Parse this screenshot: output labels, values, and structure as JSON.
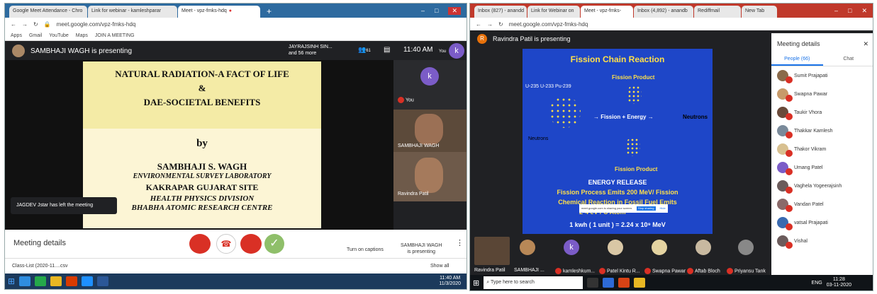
{
  "left": {
    "tabs": [
      "Google Meet Attendance - Chro",
      "Link for webinar - kamleshparar",
      "Meet - vpz-fmks-hdq"
    ],
    "url": "meet.google.com/vpz-fmks-hdq",
    "bookmarks": [
      "Apps",
      "Gmail",
      "YouTube",
      "Maps",
      "JOIN A MEETING"
    ],
    "presenter": "SAMBHAJI WAGH is presenting",
    "joined": "JAYRAJSINH SIN...",
    "joined_more": "and 56 more",
    "count": "61",
    "time": "11:40 AM",
    "you": "You",
    "avatar": "k",
    "slide": {
      "title1": "NATURAL RADIATION-A FACT OF LIFE",
      "amp": "&",
      "title2": "DAE-SOCIETAL BENEFITS",
      "by": "by",
      "author": "SAMBHAJI S. WAGH",
      "lab": "ENVIRONMENTAL SURVEY LABORATORY",
      "site": "KAKRAPAR GUJARAT SITE",
      "div": "HEALTH PHYSICS DIVISION",
      "centre": "BHABHA ATOMIC RESEARCH CENTRE"
    },
    "tiles": [
      "You",
      "SAMBHAJI WAGH",
      "Ravindra Patil"
    ],
    "toast": "JAGDEV Jstar has left the meeting",
    "details": "Meeting details",
    "captions": "Turn on captions",
    "presenting1": "SAMBHAJI WAGH",
    "presenting2": "is presenting",
    "download": "Class-List (2020-11....csv",
    "show_all": "Show all",
    "tray_time": "11:40 AM",
    "tray_date": "11/3/2020"
  },
  "right": {
    "tabs": [
      "Inbox (827) - anandd",
      "Link for Webinar on",
      "Meet - vpz-fmks-",
      "Inbox (4,892) - anandb",
      "Rediffmail",
      "New Tab"
    ],
    "url": "meet.google.com/vpz-fmks-hdq",
    "presenter_initial": "R",
    "presenter": "Ravindra Patil is presenting",
    "slide": {
      "title": "Fission Chain Reaction",
      "fp1": "Fission Product",
      "isotopes": "U-235   U-233   Pu-239",
      "fe": "Fission + Energy",
      "neutrons1": "Neutrons",
      "neutrons2": "Neutrons",
      "fp2": "Fission Product",
      "release": "ENERGY RELEASE",
      "line1": "Fission  Process Emits 200 MeV/ Fission",
      "line2": "Chemical  Reaction in Fossil Fuel Emits",
      "line3": "2-4 eV / C Atom",
      "line4": "1 kwh ( 1 unit ) = 2.24 x 10⁹ MeV"
    },
    "share_note": "meet.google.com is sharing your screen.",
    "stop": "Stop sharing",
    "hide": "Hide",
    "details": "Meeting details",
    "people_tab": "People (66)",
    "chat_tab": "Chat",
    "people": [
      "Sumit Prajapati",
      "Swapna Pawar",
      "Taukir Vhora",
      "Thakkar Kamlesh",
      "Thakor Vikram",
      "Umang Patel",
      "Vaghela Yogeerajsinh",
      "Vandan Patel",
      "vatsal Prajapati",
      "Vishal"
    ],
    "bottom": [
      "Ravindra Patil",
      "SAMBHAJI ...",
      "kamleshkum...",
      "Patel Kintu R...",
      "Swapna Pawar",
      "Aftab Bloch",
      "Priyansu Tank"
    ],
    "search": "Type here to search",
    "tray_time": "11:28",
    "tray_date": "03-11-2020",
    "lang": "ENG"
  }
}
